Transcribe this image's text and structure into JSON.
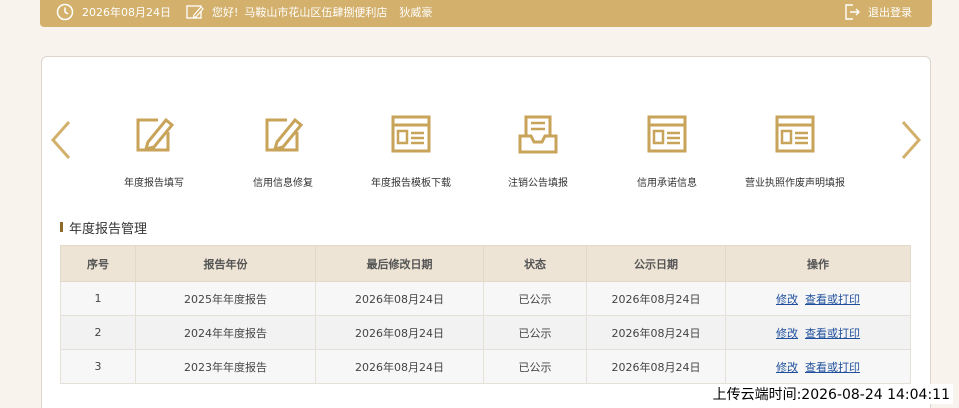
{
  "colors": {
    "accent": "#d3b06b",
    "accent_dark": "#c4a15a",
    "icon": "#c8a35a",
    "link": "#1f4f9c"
  },
  "header": {
    "date": "2026年08月24日",
    "greeting": "您好!",
    "store_name": "马鞍山市花山区伍肆捌便利店",
    "user_name": "狄威豪",
    "logout_label": "退出登录",
    "icons": [
      "clock-icon",
      "edit-icon",
      "logout-icon"
    ]
  },
  "menu": {
    "items": [
      {
        "label": "年度报告填写",
        "icon": "pen-edit-icon"
      },
      {
        "label": "信用信息修复",
        "icon": "pen-edit-icon"
      },
      {
        "label": "年度报告模板下载",
        "icon": "document-template-icon"
      },
      {
        "label": "注销公告填报",
        "icon": "inbox-document-icon"
      },
      {
        "label": "信用承诺信息",
        "icon": "document-template-icon"
      },
      {
        "label": "营业执照作废声明填报",
        "icon": "document-template-icon"
      }
    ],
    "prev_icon": "chevron-left-icon",
    "next_icon": "chevron-right-icon"
  },
  "section": {
    "title": "年度报告管理"
  },
  "table": {
    "columns": [
      "序号",
      "报告年份",
      "最后修改日期",
      "状态",
      "公示日期",
      "操作"
    ],
    "rows": [
      {
        "index": "1",
        "year": "2025年年度报告",
        "modified": "2026年08月24日",
        "status": "已公示",
        "published": "2026年08月24日",
        "edit": "修改",
        "view": "查看或打印"
      },
      {
        "index": "2",
        "year": "2024年年度报告",
        "modified": "2026年08月24日",
        "status": "已公示",
        "published": "2026年08月24日",
        "edit": "修改",
        "view": "查看或打印"
      },
      {
        "index": "3",
        "year": "2023年年度报告",
        "modified": "2026年08月24日",
        "status": "已公示",
        "published": "2026年08月24日",
        "edit": "修改",
        "view": "查看或打印"
      }
    ]
  },
  "footer": {
    "upload_time": "上传云端时间:2026-08-24 14:04:11"
  }
}
